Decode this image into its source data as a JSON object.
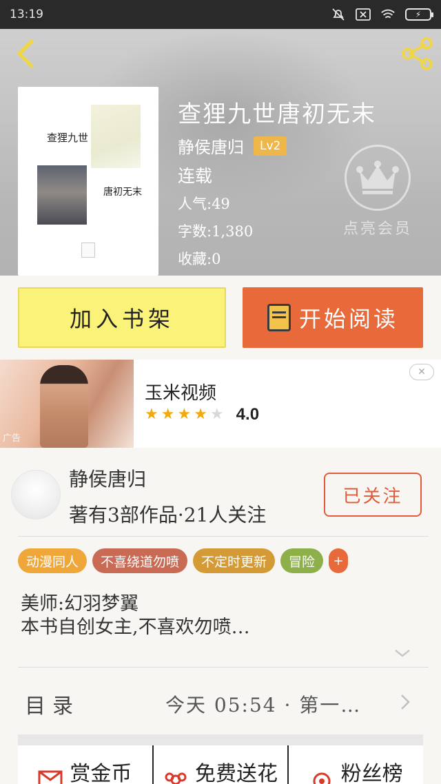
{
  "status_bar": {
    "time": "13:19",
    "battery": "⚡"
  },
  "book": {
    "title": "查狸九世唐初无末",
    "cover_text_a": "查狸九世",
    "cover_text_b": "唐初无末",
    "author": "静侯唐归",
    "level": "Lv2",
    "status": "连载",
    "popularity": "人气:49",
    "word_count": "字数:1,380",
    "favorites": "收藏:0",
    "vip_label": "点亮会员"
  },
  "actions": {
    "add_to_shelf": "加入书架",
    "start_reading": "开始阅读"
  },
  "ad": {
    "label": "广告",
    "title": "玉米视频",
    "rating": 4,
    "rating_max": 5,
    "score": "4.0",
    "close": "✕"
  },
  "author_section": {
    "name": "静侯唐归",
    "works": "著有3部作品·21人关注",
    "follow_label": "已关注"
  },
  "tags": [
    {
      "label": "动漫同人",
      "color": "#efa73a"
    },
    {
      "label": "不喜绕道勿喷",
      "color": "#c96a55"
    },
    {
      "label": "不定时更新",
      "color": "#d49a36"
    },
    {
      "label": "冒险",
      "color": "#8db04a"
    }
  ],
  "tag_more": "+",
  "description": {
    "line1": "美师:幻羽梦翼",
    "line2": "本书自创女主,不喜欢勿喷…"
  },
  "toc": {
    "label": "目录",
    "latest": "今天 05:54 · 第一…"
  },
  "bottom_bar": {
    "items": [
      {
        "label": "赏金币",
        "icon": "envelope-icon"
      },
      {
        "label": "免费送花",
        "icon": "flower-icon"
      },
      {
        "label": "粉丝榜",
        "icon": "fans-icon"
      }
    ]
  },
  "colors": {
    "accent_orange": "#e8693a",
    "shelf_yellow": "#fbf27a",
    "level_badge": "#efb64a",
    "follow_red": "#e05b3a"
  }
}
